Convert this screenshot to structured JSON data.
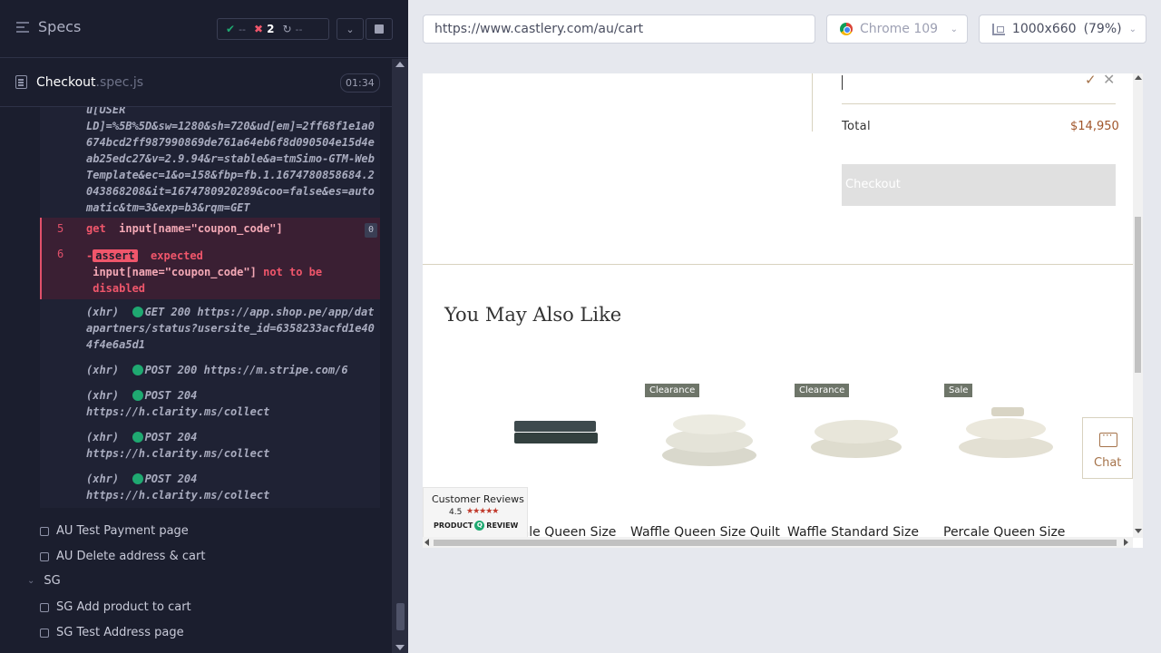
{
  "reporter": {
    "header": {
      "title": "Specs",
      "passed": "--",
      "failed": "2",
      "pending": "--"
    },
    "spec": {
      "name": "Checkout",
      "ext": ".spec.js",
      "duration": "01:34"
    },
    "log": {
      "url_text": "u[USER\nLD]=%5B%5D&sw=1280&sh=720&ud[em]=2ff68f1e1a0674bcd2ff987990869de761a64eb6f8d090504e15d4eab25edc27&v=2.9.94&r=stable&a=tmSimo-GTM-WebTemplate&ec=1&o=158&fbp=fb.1.1674780858684.2043868208&it=1674780920289&coo=false&es=automatic&tm=3&exp=b3&rqm=GET",
      "cmd5": {
        "num": "5",
        "name": "get",
        "selector": "input[name=\"coupon_code\"]",
        "count": "0"
      },
      "cmd6": {
        "num": "6",
        "prefix": "-",
        "name": "assert",
        "text1": "expected",
        "selector": "input[name=\"coupon_code\"]",
        "text2": "not to be",
        "text3": "disabled"
      },
      "xhr": [
        {
          "tag": "(xhr)",
          "method": "GET 200",
          "url": "https://app.shop.pe/app/datapartners/status?usersite_id=6358233acfd1e404f4e6a5d1"
        },
        {
          "tag": "(xhr)",
          "method": "POST 200",
          "url": "https://m.stripe.com/6"
        },
        {
          "tag": "(xhr)",
          "method": "POST 204",
          "url": "https://h.clarity.ms/collect"
        },
        {
          "tag": "(xhr)",
          "method": "POST 204",
          "url": "https://h.clarity.ms/collect"
        },
        {
          "tag": "(xhr)",
          "method": "POST 204",
          "url": "https://h.clarity.ms/collect"
        }
      ]
    },
    "tests": [
      "AU Test Payment page",
      "AU Delete address & cart"
    ],
    "suite": "SG",
    "suite_tests": [
      "SG Add product to cart",
      "SG Test Address page"
    ]
  },
  "browser": {
    "url": "https://www.castlery.com/au/cart",
    "browser_name": "Chrome 109",
    "viewport": "1000x660",
    "zoom": "(79%)"
  },
  "page": {
    "total_label": "Total",
    "total_value": "$14,950",
    "checkout_label": "Checkout",
    "section_title": "You May Also Like",
    "products": [
      {
        "badge": "",
        "name": "Percale Queen Size"
      },
      {
        "badge": "Clearance",
        "name": "Waffle Queen Size Quilt"
      },
      {
        "badge": "Clearance",
        "name": "Waffle Standard Size"
      },
      {
        "badge": "Sale",
        "name": "Percale Queen Size"
      }
    ],
    "chat_label": "Chat",
    "reviews": {
      "title": "Customer Reviews",
      "score": "4.5",
      "stars": "★★★★★",
      "logo": "PRODUCT",
      "logo2": "REVIEW"
    }
  },
  "colors": {
    "pass": "#1fa971",
    "fail": "#f0566b",
    "accent": "#a5734a",
    "badge": "#6e7569"
  }
}
